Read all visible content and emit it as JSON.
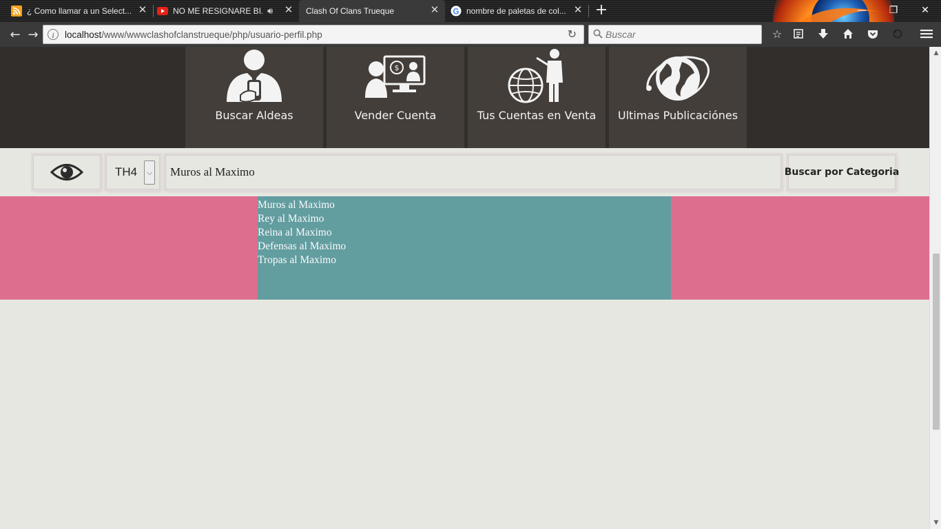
{
  "browser": {
    "tabs": [
      {
        "label": "¿ Como llamar a un Select...",
        "icon": "rss-icon"
      },
      {
        "label": "NO ME RESIGNARE BI...",
        "icon": "youtube-icon",
        "audio": true
      },
      {
        "label": "Clash Of Clans Trueque",
        "icon": "none",
        "active": true
      },
      {
        "label": "nombre de paletas de col...",
        "icon": "google-icon"
      }
    ],
    "url_host": "localhost",
    "url_path": "/www/wwwclashofclanstrueque/php/usuario-perfil.php",
    "search_placeholder": "Buscar"
  },
  "header": {
    "tiles": [
      {
        "label": "Buscar Aldeas",
        "icon": "person-with-phone-icon"
      },
      {
        "label": "Vender Cuenta",
        "icon": "seller-with-monitor-icon"
      },
      {
        "label": "Tus Cuentas en Venta",
        "icon": "presenter-with-globe-icon"
      },
      {
        "label": "Ultimas Publicaciónes",
        "icon": "globe-with-orbit-icon"
      }
    ]
  },
  "filter": {
    "th_value": "TH4",
    "search_value": "Muros al Maximo",
    "category_button": "Buscar por Categoria"
  },
  "results": {
    "items": [
      "Muros al Maximo",
      "Rey al Maximo",
      "Reina al Maximo",
      "Defensas al Maximo",
      "Tropas al Maximo"
    ]
  },
  "colors": {
    "header_bg": "#322e2b",
    "tile_bg": "#433e3a",
    "page_bg": "#e6e7e1",
    "pink": "#de6e8e",
    "teal": "#629da0"
  }
}
